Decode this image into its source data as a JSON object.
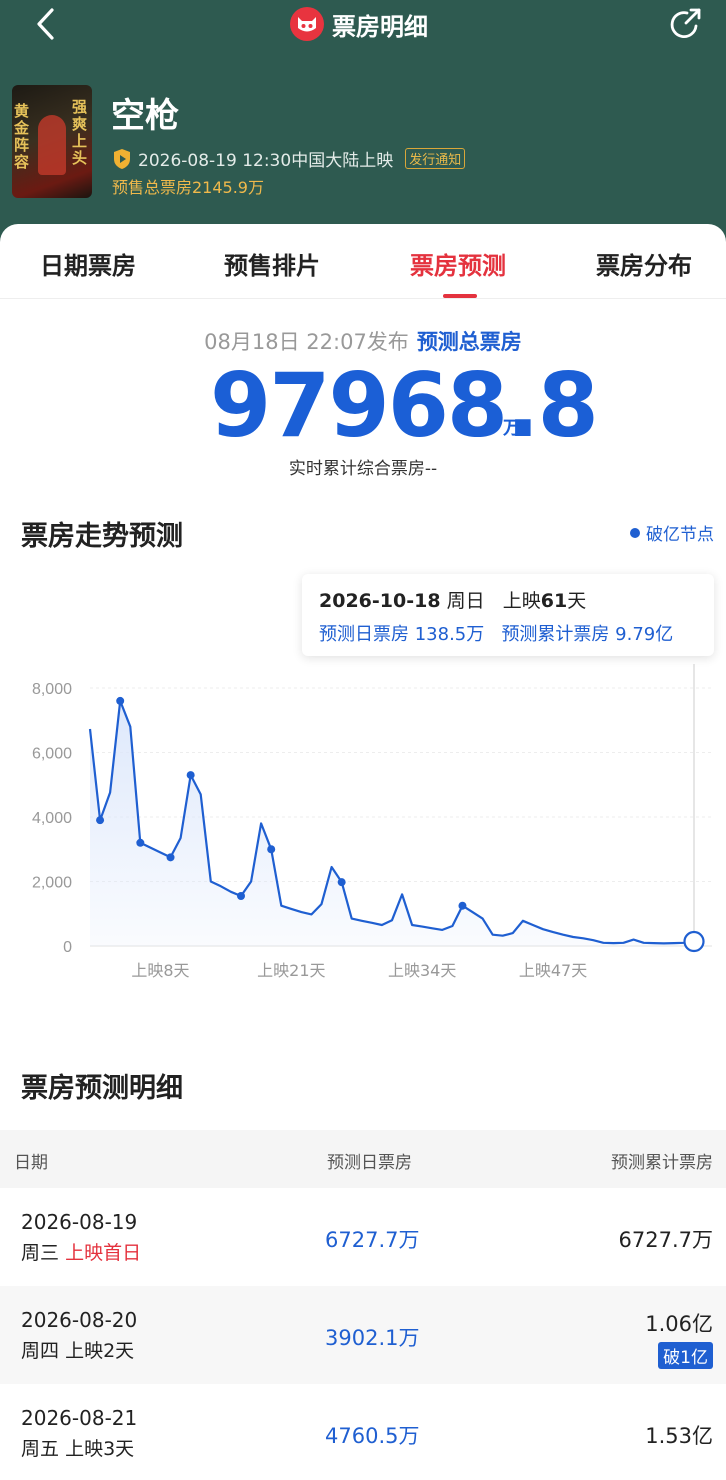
{
  "nav": {
    "title": "票房明细",
    "back_icon": "chevron-left-icon",
    "share_icon": "share-icon",
    "logo_icon": "maoyan-cat-logo-icon"
  },
  "movie": {
    "title": "空枪",
    "release_info": "2026-08-19 12:30中国大陆上映",
    "release_badge": "发行通知",
    "presale": "预售总票房2145.9万",
    "poster_text_left": "黄金阵容",
    "poster_text_right": "强爽上头"
  },
  "tabs": [
    {
      "label": "日期票房",
      "active": false
    },
    {
      "label": "预售排片",
      "active": false
    },
    {
      "label": "票房预测",
      "active": true
    },
    {
      "label": "票房分布",
      "active": false
    }
  ],
  "forecast": {
    "published": "08月18日 22:07发布",
    "label": "预测总票房",
    "total": "97968.8",
    "unit": "万",
    "realtime": "实时累计综合票房--"
  },
  "chart_section": {
    "title": "票房走势预测",
    "legend": "破亿节点",
    "tooltip": {
      "date": "2026-10-18",
      "weekday": "周日",
      "day_prefix": "上映",
      "day_num": "61",
      "day_suffix": "天",
      "daily": "预测日票房 138.5万",
      "cumulative": "预测累计票房 9.79亿"
    }
  },
  "chart_data": {
    "type": "line",
    "x": [
      1,
      2,
      3,
      4,
      5,
      6,
      7,
      8,
      9,
      10,
      11,
      12,
      13,
      14,
      15,
      16,
      17,
      18,
      19,
      20,
      21,
      22,
      23,
      24,
      25,
      26,
      27,
      28,
      29,
      30,
      31,
      32,
      33,
      34,
      35,
      36,
      37,
      38,
      39,
      40,
      41,
      42,
      43,
      44,
      45,
      46,
      47,
      48,
      49,
      50,
      51,
      52,
      53,
      54,
      55,
      56,
      57,
      58,
      59,
      60,
      61
    ],
    "values": [
      6728,
      3902,
      4761,
      7600,
      6800,
      3200,
      3050,
      2900,
      2750,
      3350,
      5300,
      4700,
      2000,
      1850,
      1680,
      1550,
      2000,
      3800,
      3000,
      1250,
      1150,
      1050,
      980,
      1300,
      2450,
      1980,
      850,
      780,
      720,
      650,
      800,
      1600,
      650,
      600,
      550,
      500,
      620,
      1250,
      1050,
      850,
      350,
      320,
      400,
      780,
      650,
      520,
      430,
      350,
      280,
      240,
      180,
      100,
      90,
      100,
      200,
      100,
      90,
      80,
      90,
      100,
      138.5
    ],
    "title": "票房走势预测",
    "xlabel": "",
    "ylabel": "",
    "xticks": [
      {
        "x": 8,
        "label": "上映8天"
      },
      {
        "x": 21,
        "label": "上映21天"
      },
      {
        "x": 34,
        "label": "上映34天"
      },
      {
        "x": 47,
        "label": "上映47天"
      }
    ],
    "yticks": [
      "0",
      "2,000",
      "4,000",
      "6,000",
      "8,000"
    ],
    "ylim": [
      0,
      8000
    ],
    "xlim": [
      1,
      61
    ],
    "grid": true,
    "marker_points": [
      2,
      4,
      6,
      9,
      11,
      16,
      19,
      26,
      38
    ],
    "highlight_point": 61,
    "line_color": "#1f5fd1",
    "fill_color": "#dce7fb"
  },
  "detail": {
    "title": "票房预测明细",
    "columns": [
      "日期",
      "预测日票房",
      "预测累计票房"
    ],
    "rows": [
      {
        "date": "2026-08-19",
        "weekday": "周三",
        "day": "上映首日",
        "day_highlight": true,
        "daily": "6727.7万",
        "cumulative": "6727.7万",
        "tag": ""
      },
      {
        "date": "2026-08-20",
        "weekday": "周四",
        "day": "上映2天",
        "day_highlight": false,
        "daily": "3902.1万",
        "cumulative": "1.06亿",
        "tag": "破1亿"
      },
      {
        "date": "2026-08-21",
        "weekday": "周五",
        "day": "上映3天",
        "day_highlight": false,
        "daily": "4760.5万",
        "cumulative": "1.53亿",
        "tag": ""
      }
    ]
  }
}
